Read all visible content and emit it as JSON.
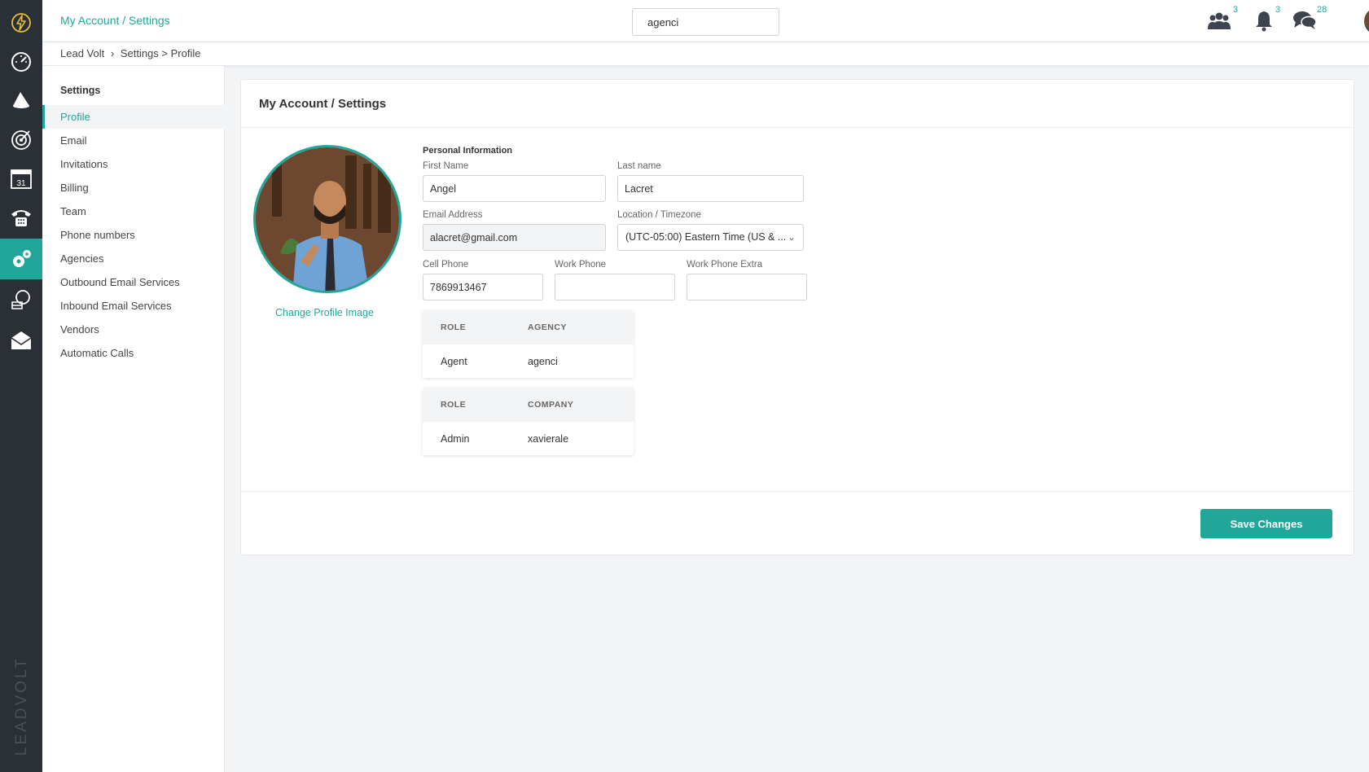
{
  "header": {
    "title": "My Account / Settings",
    "search_value": "agenci",
    "team_count": "3",
    "notifications_count": "3",
    "messages_count": "28"
  },
  "breadcrumb": [
    "Lead Volt",
    "›",
    "Settings > Profile"
  ],
  "sidebar": {
    "heading": "Settings",
    "items": [
      {
        "label": "Profile",
        "active": true
      },
      {
        "label": "Email"
      },
      {
        "label": "Invitations"
      },
      {
        "label": "Billing"
      },
      {
        "label": "Team"
      },
      {
        "label": "Phone numbers"
      },
      {
        "label": "Agencies"
      },
      {
        "label": "Outbound Email Services"
      },
      {
        "label": "Inbound Email Services"
      },
      {
        "label": "Vendors"
      },
      {
        "label": "Automatic Calls"
      }
    ]
  },
  "rail": {
    "icons": [
      "bolt-logo-icon",
      "dashboard-gauge-icon",
      "megaphone-icon",
      "target-icon",
      "calendar-icon",
      "phone-icon",
      "settings-gears-icon",
      "money-gear-icon",
      "mail-icon"
    ],
    "calendar_day": "31",
    "brand_vertical": "LEADVOLT"
  },
  "card": {
    "title": "My Account / Settings",
    "change_image": "Change Profile Image",
    "section": "Personal Information",
    "fields": {
      "first_name": {
        "label": "First Name",
        "value": "Angel"
      },
      "last_name": {
        "label": "Last name",
        "value": "Lacret"
      },
      "email": {
        "label": "Email Address",
        "value": "alacret@gmail.com"
      },
      "location": {
        "label": "Location / Timezone",
        "value": "(UTC-05:00) Eastern Time (US & ..."
      },
      "cell_phone": {
        "label": "Cell Phone",
        "value": "7869913467"
      },
      "work_phone": {
        "label": "Work Phone",
        "value": ""
      },
      "work_phone_extra": {
        "label": "Work Phone Extra",
        "value": ""
      }
    },
    "agency_table": {
      "h1": "ROLE",
      "h2": "AGENCY",
      "role": "Agent",
      "name": "agenci"
    },
    "company_table": {
      "h1": "ROLE",
      "h2": "COMPANY",
      "role": "Admin",
      "name": "xavierale"
    },
    "save_label": "Save Changes"
  },
  "colors": {
    "accent": "#22a699",
    "rail": "#2b2f36"
  }
}
